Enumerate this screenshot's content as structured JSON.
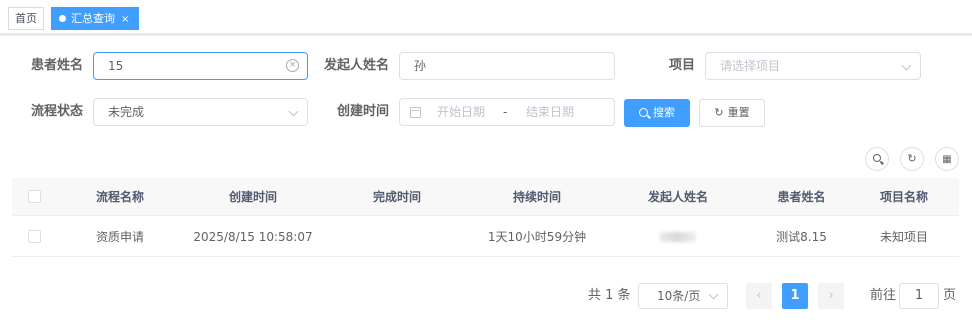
{
  "tags": {
    "home": "首页",
    "active": "汇总查询",
    "close": "×"
  },
  "form": {
    "patient_label": "患者姓名",
    "patient_value": "15",
    "initiator_label": "发起人姓名",
    "initiator_value": "孙",
    "project_label": "项目",
    "project_placeholder": "请选择项目",
    "status_label": "流程状态",
    "status_value": "未完成",
    "created_label": "创建时间",
    "start_placeholder": "开始日期",
    "range_sep": "-",
    "end_placeholder": "结束日期",
    "search_label": "搜索",
    "reset_label": "重置"
  },
  "toolbar": {
    "search_icon": "search-icon",
    "refresh_icon": "refresh-icon",
    "columns_icon": "grid-icon"
  },
  "table": {
    "columns": [
      "流程名称",
      "创建时间",
      "完成时间",
      "持续时间",
      "发起人姓名",
      "患者姓名",
      "项目名称"
    ],
    "rows": [
      {
        "name": "资质申请",
        "created": "2025/8/15 10:58:07",
        "completed": "",
        "duration": "1天10小时59分钟",
        "initiator": "",
        "patient": "测试8.15",
        "project": "未知项目"
      }
    ]
  },
  "pagination": {
    "total": "共 1 条",
    "page_size": "10条/页",
    "prev": "‹",
    "current": "1",
    "next": "›",
    "goto": "前往",
    "goto_value": "1",
    "page_unit": "页"
  },
  "colors": {
    "primary": "#409eff",
    "border": "#dcdfe6",
    "header_bg": "#f8f8f9"
  }
}
